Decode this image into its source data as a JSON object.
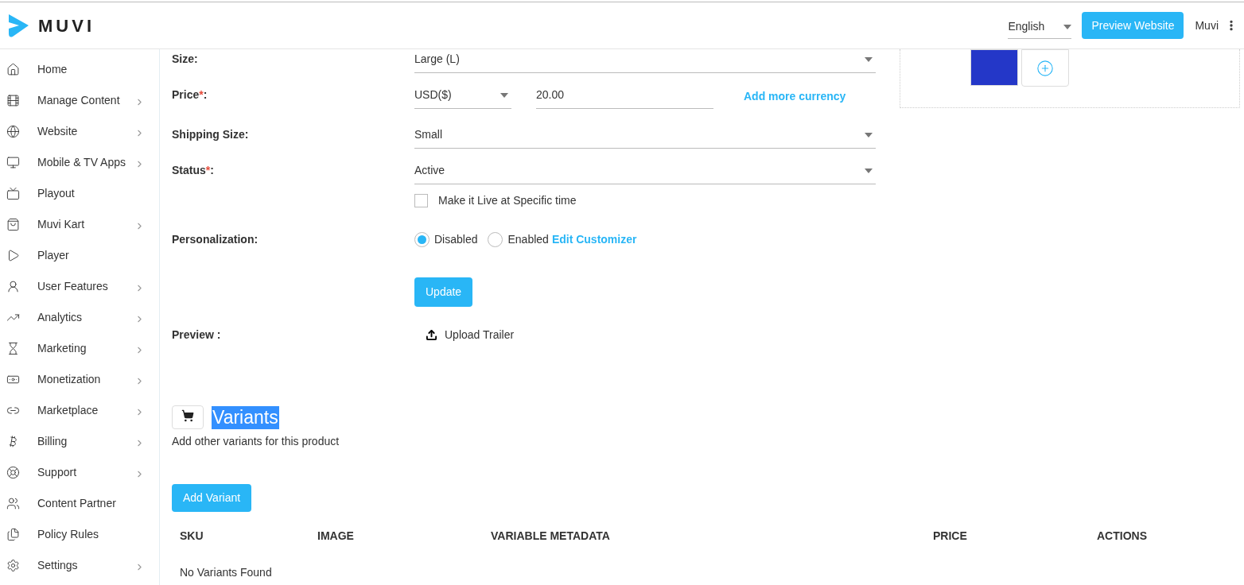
{
  "header": {
    "logo_text": "MUVI",
    "language": {
      "value": "English"
    },
    "preview_button": "Preview Website",
    "user": "Muvi"
  },
  "sidebar": {
    "items": [
      {
        "label": "Home",
        "has_submenu": false
      },
      {
        "label": "Manage Content",
        "has_submenu": true
      },
      {
        "label": "Website",
        "has_submenu": true
      },
      {
        "label": "Mobile & TV Apps",
        "has_submenu": true
      },
      {
        "label": "Playout",
        "has_submenu": false
      },
      {
        "label": "Muvi Kart",
        "has_submenu": true
      },
      {
        "label": "Player",
        "has_submenu": false
      },
      {
        "label": "User Features",
        "has_submenu": true
      },
      {
        "label": "Analytics",
        "has_submenu": true
      },
      {
        "label": "Marketing",
        "has_submenu": true
      },
      {
        "label": "Monetization",
        "has_submenu": true
      },
      {
        "label": "Marketplace",
        "has_submenu": true
      },
      {
        "label": "Billing",
        "has_submenu": true
      },
      {
        "label": "Support",
        "has_submenu": true
      },
      {
        "label": "Content Partner",
        "has_submenu": false
      },
      {
        "label": "Policy Rules",
        "has_submenu": false
      },
      {
        "label": "Settings",
        "has_submenu": true
      }
    ]
  },
  "form": {
    "rows": [
      {
        "kind": "select",
        "label": "Size",
        "label_suffix": ":",
        "value": "Large (L)"
      },
      {
        "kind": "price",
        "label": "Price",
        "required_mark": "*",
        "label_suffix": ":",
        "currency": "USD($)",
        "amount": "20.00",
        "link": "Add more currency"
      },
      {
        "kind": "select",
        "label": "Shipping Size",
        "label_suffix": ":",
        "value": "Small"
      },
      {
        "kind": "select",
        "label": "Status",
        "required_mark": "*",
        "label_suffix": ":",
        "value": "Active"
      },
      {
        "kind": "checkbox",
        "label": "Make it Live at Specific time",
        "checked": false
      },
      {
        "kind": "radio",
        "label": "Personalization:",
        "options": [
          {
            "label": "Disabled",
            "selected": true
          },
          {
            "label": "Enabled",
            "selected": false
          }
        ],
        "link": "Edit Customizer"
      },
      {
        "kind": "button",
        "label": "Update"
      },
      {
        "kind": "upload",
        "label": "Preview :",
        "action": "Upload Trailer"
      }
    ]
  },
  "variants": {
    "title": "Variants",
    "title_highlighted": true,
    "subtitle": "Add other variants for this product",
    "add_button": "Add Variant",
    "table": {
      "columns": [
        "SKU",
        "IMAGE",
        "VARIABLE METADATA",
        "PRICE",
        "ACTIONS"
      ],
      "empty_message": "No Variants Found"
    }
  }
}
